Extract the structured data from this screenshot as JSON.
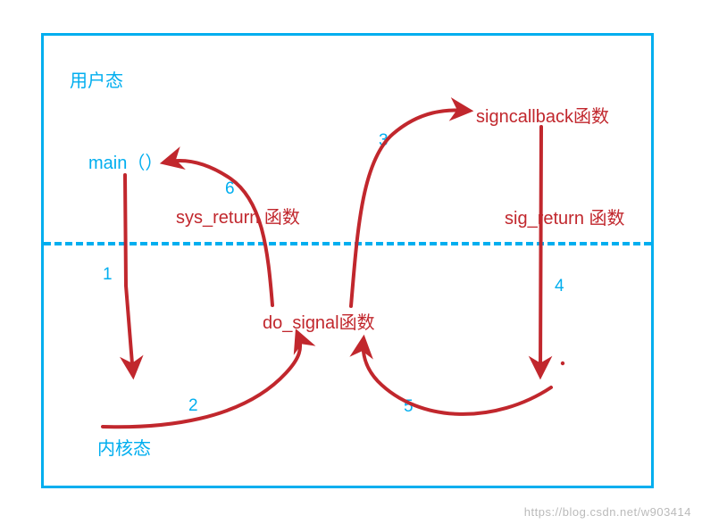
{
  "labels": {
    "user_space": "用户态",
    "kernel_space": "内核态",
    "main_fn": "main（）",
    "sign_callback": "signcallback函数",
    "do_signal": "do_signal函数",
    "sys_return": "sys_return 函数",
    "sig_return": "sig_return 函数"
  },
  "steps": {
    "s1": "1",
    "s2": "2",
    "s3": "3",
    "s4": "4",
    "s5": "5",
    "s6": "6"
  },
  "watermark": "https://blog.csdn.net/w903414"
}
